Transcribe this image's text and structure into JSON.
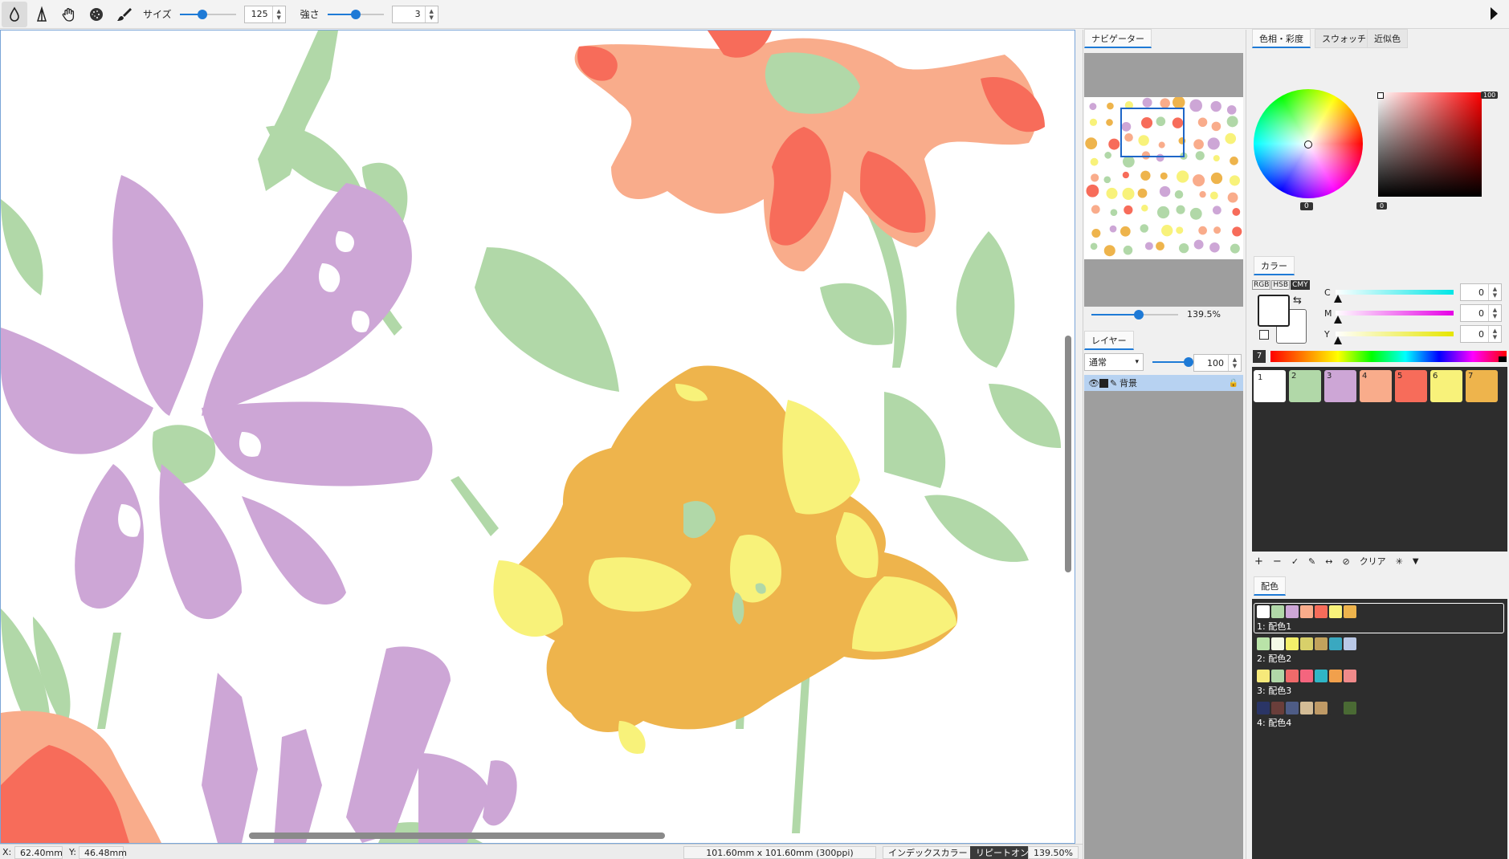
{
  "toolbar": {
    "tools": [
      "water-drop-icon",
      "triangle-icon",
      "hand-icon",
      "spray-icon",
      "brush-icon"
    ],
    "size_label": "サイズ",
    "size_value": "125",
    "size_slider": 0.4,
    "strength_label": "強さ",
    "strength_value": "3",
    "strength_slider": 0.5
  },
  "navigator": {
    "tab": "ナビゲーター",
    "zoom": "139.5%",
    "zoom_slider": 0.55
  },
  "layers": {
    "tab": "レイヤー",
    "blend_mode": "通常",
    "opacity": "100",
    "opacity_slider": 1.0,
    "rows": [
      {
        "name": "背景"
      }
    ]
  },
  "color_tabs": [
    "色相・彩度",
    "スウォッチ",
    "近似色"
  ],
  "hue": {
    "saturation_value": "0",
    "corner_value": "100",
    "brightness_value": "0"
  },
  "color_panel": {
    "tab": "カラー",
    "modes": [
      "RGB",
      "HSB",
      "CMY"
    ],
    "channels": [
      {
        "label": "C",
        "value": "0"
      },
      {
        "label": "M",
        "value": "0"
      },
      {
        "label": "Y",
        "value": "0"
      }
    ],
    "spectrum_index": "7"
  },
  "swatches": [
    {
      "label": "1",
      "color": "#ffffff"
    },
    {
      "label": "2",
      "color": "#b1d8a8"
    },
    {
      "label": "3",
      "color": "#cda6d6"
    },
    {
      "label": "4",
      "color": "#f9ac8b"
    },
    {
      "label": "5",
      "color": "#f76c5a"
    },
    {
      "label": "6",
      "color": "#f8f27a"
    },
    {
      "label": "7",
      "color": "#eeb44c"
    }
  ],
  "swatch_toolbar": {
    "clear_label": "クリア"
  },
  "schemes": {
    "tab": "配色",
    "items": [
      {
        "label": "1: 配色1",
        "colors": [
          "#ffffff",
          "#b1d8a8",
          "#cda6d6",
          "#f9ac8b",
          "#f76c5a",
          "#f8f27a",
          "#eeb44c"
        ]
      },
      {
        "label": "2: 配色2",
        "colors": [
          "#b9e3a8",
          "#f3f9e6",
          "#f4f06a",
          "#d8d06a",
          "#c2a25c",
          "#3aa8c0",
          "#b9c8e6"
        ]
      },
      {
        "label": "3: 配色3",
        "colors": [
          "#f6e97a",
          "#b1d8a8",
          "#f06a6a",
          "#f4657e",
          "#2fb6c6",
          "#f1a04c",
          "#f08a8a"
        ]
      },
      {
        "label": "4: 配色4",
        "colors": [
          "#2a3566",
          "#6a3e3a",
          "#4e5c86",
          "#d3bc96",
          "#bf9a66",
          "#2d2d2d",
          "#4a6a34"
        ]
      }
    ]
  },
  "status": {
    "x_label": "X:",
    "x_value": "62.40mm",
    "y_label": "Y:",
    "y_value": "46.48mm",
    "doc_size": "101.60mm x 101.60mm (300ppi)",
    "color_mode": "インデックスカラー",
    "repeat": "リピートオン",
    "zoom": "139.50%"
  }
}
